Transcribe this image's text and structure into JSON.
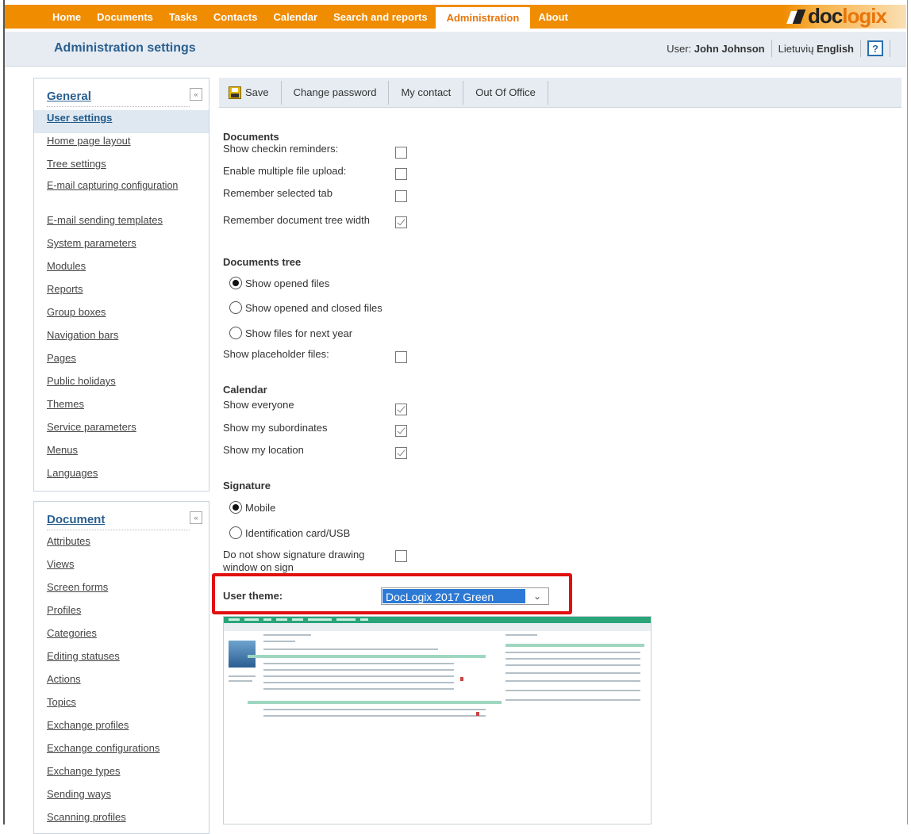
{
  "topnav": {
    "items": [
      "Home",
      "Documents",
      "Tasks",
      "Contacts",
      "Calendar",
      "Search and reports",
      "Administration",
      "About"
    ],
    "active_index": 6,
    "logo": {
      "part1": "doc",
      "part2": "logix"
    }
  },
  "header": {
    "title": "Administration settings",
    "user_prefix": "User:",
    "user_name": "John Johnson",
    "lang1": "Lietuvių",
    "lang2": "English",
    "help": "?"
  },
  "sidebar": {
    "general": {
      "title": "General",
      "collapse": "«",
      "items": [
        "User settings",
        "Home page layout",
        "Tree settings",
        "E-mail capturing configuration",
        "E-mail sending templates",
        "System parameters",
        "Modules",
        "Reports",
        "Group boxes",
        "Navigation bars",
        "Pages",
        "Public holidays",
        "Themes",
        "Service parameters",
        "Menus",
        "Languages"
      ],
      "active_index": 0
    },
    "document": {
      "title": "Document",
      "collapse": "«",
      "items": [
        "Attributes",
        "Views",
        "Screen forms",
        "Profiles",
        "Categories",
        "Editing statuses",
        "Actions",
        "Topics",
        "Exchange profiles",
        "Exchange configurations",
        "Exchange types",
        "Sending ways",
        "Scanning profiles"
      ]
    }
  },
  "toolbar": {
    "save": "Save",
    "change_password": "Change password",
    "my_contact": "My contact",
    "out_of_office": "Out Of Office"
  },
  "form": {
    "documents": {
      "title": "Documents",
      "show_checkin": {
        "label": "Show checkin reminders:",
        "checked": false
      },
      "multi_upload": {
        "label": "Enable multiple file upload:",
        "checked": false
      },
      "remember_tab": {
        "label": "Remember selected tab",
        "checked": false
      },
      "remember_tree": {
        "label": "Remember document tree width",
        "checked": true
      }
    },
    "documents_tree": {
      "title": "Documents tree",
      "options": [
        "Show opened files",
        "Show opened and closed files",
        "Show files for next year"
      ],
      "selected_index": 0,
      "placeholder_files": {
        "label": "Show placeholder files:",
        "checked": false
      }
    },
    "calendar": {
      "title": "Calendar",
      "show_everyone": {
        "label": "Show everyone",
        "checked": true
      },
      "show_subordinates": {
        "label": "Show my subordinates",
        "checked": true
      },
      "show_location": {
        "label": "Show my location",
        "checked": true
      }
    },
    "signature": {
      "title": "Signature",
      "options": [
        "Mobile",
        "Identification card/USB"
      ],
      "selected_index": 0,
      "no_drawing": {
        "label": "Do not show signature drawing window on sign",
        "checked": false
      }
    },
    "user_theme": {
      "label": "User theme:",
      "value": "DocLogix 2017 Green"
    }
  },
  "colors": {
    "nav_orange": "#f08c00",
    "title_blue": "#2a5f8f",
    "highlight_red": "#e01010",
    "preview_green": "#2aa57a"
  }
}
